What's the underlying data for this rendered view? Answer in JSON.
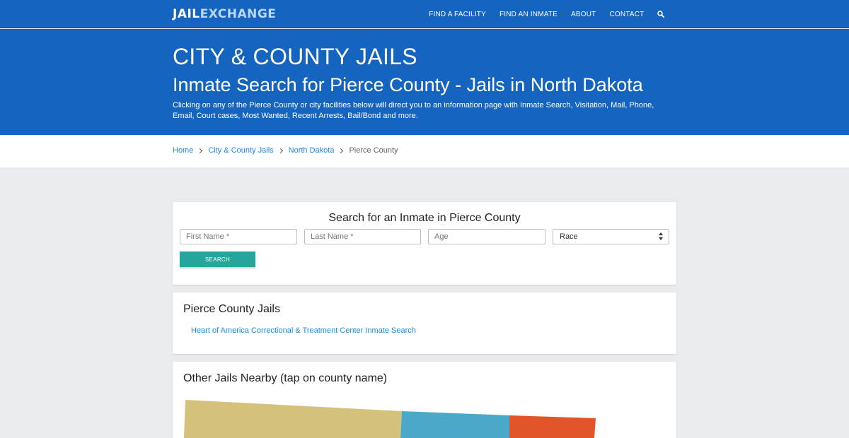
{
  "nav": {
    "logo_part1": "JAIL",
    "logo_part2": "EXCHANGE",
    "links": [
      "FIND A FACILITY",
      "FIND AN INMATE",
      "ABOUT",
      "CONTACT"
    ],
    "search_icon": "search-icon"
  },
  "hero": {
    "eyebrow": "CITY & COUNTY JAILS",
    "title": "Inmate Search for Pierce County - Jails in North Dakota",
    "description": "Clicking on any of the Pierce County or city facilities below will direct you to an information page with Inmate Search, Visitation, Mail, Phone, Email, Court cases, Most Wanted, Recent Arrests, Bail/Bond and more."
  },
  "breadcrumb": {
    "items": [
      "Home",
      "City & County Jails",
      "North Dakota"
    ],
    "current": "Pierce County"
  },
  "search": {
    "title": "Search for an Inmate in Pierce County",
    "first_name_placeholder": "First Name *",
    "last_name_placeholder": "Last Name *",
    "age_placeholder": "Age",
    "race_selected": "Race",
    "button_label": "SEARCH"
  },
  "jails": {
    "heading": "Pierce County Jails",
    "link": "Heart of America Correctional & Treatment Center Inmate Search"
  },
  "nearby": {
    "heading": "Other Jails Nearby (tap on county name)",
    "map_colors": [
      "#d4c27a",
      "#4aa9c6",
      "#e2552a"
    ]
  },
  "colors": {
    "brand_blue": "#1565c0",
    "link_blue": "#1e88e5",
    "button_teal": "#26a69a",
    "page_bg": "#e9ecef"
  }
}
